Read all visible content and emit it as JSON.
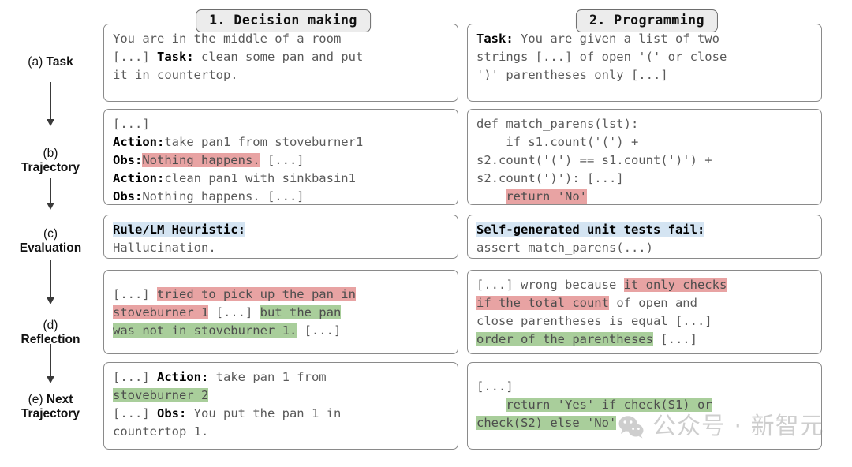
{
  "stages": [
    {
      "index": "(a)",
      "name": "Task",
      "inline": true
    },
    {
      "index": "(b)",
      "name": "Trajectory",
      "inline": false
    },
    {
      "index": "(c)",
      "name": "Evaluation",
      "inline": false
    },
    {
      "index": "(d)",
      "name": "Reflection",
      "inline": false
    },
    {
      "index": "(e)",
      "name": "Next",
      "name2": "Trajectory",
      "inline": true
    }
  ],
  "columns": [
    {
      "title": "1. Decision making",
      "task": {
        "lines": [
          {
            "segments": [
              {
                "t": "You are in the middle of a room",
                "style": "plain"
              }
            ]
          },
          {
            "segments": [
              {
                "t": "[...] ",
                "style": "plain"
              },
              {
                "t": "Task:",
                "style": "bold"
              },
              {
                "t": " clean some pan and put",
                "style": "plain"
              }
            ]
          },
          {
            "segments": [
              {
                "t": "it in countertop.",
                "style": "plain"
              }
            ]
          }
        ]
      },
      "trajectory": {
        "lines": [
          {
            "segments": [
              {
                "t": "[...]",
                "style": "plain"
              }
            ]
          },
          {
            "segments": [
              {
                "t": "Action:",
                "style": "bold"
              },
              {
                "t": "take pan1 from stoveburner1",
                "style": "plain"
              }
            ]
          },
          {
            "segments": [
              {
                "t": "Obs:",
                "style": "bold"
              },
              {
                "t": "Nothing happens.",
                "style": "red"
              },
              {
                "t": " [...]",
                "style": "plain"
              }
            ]
          },
          {
            "segments": [
              {
                "t": "Action:",
                "style": "bold"
              },
              {
                "t": "clean pan1 with sinkbasin1",
                "style": "plain"
              }
            ]
          },
          {
            "segments": [
              {
                "t": "Obs:",
                "style": "bold"
              },
              {
                "t": "Nothing happens. [...]",
                "style": "plain"
              }
            ]
          }
        ]
      },
      "evaluation": {
        "lines": [
          {
            "segments": [
              {
                "t": "Rule/LM Heuristic:",
                "style": "blue-bold"
              }
            ]
          },
          {
            "segments": [
              {
                "t": "Hallucination.",
                "style": "plain"
              }
            ]
          }
        ]
      },
      "reflection": {
        "lines": [
          {
            "segments": [
              {
                "t": "[...] ",
                "style": "plain"
              },
              {
                "t": "tried to pick up the pan in",
                "style": "red"
              }
            ]
          },
          {
            "segments": [
              {
                "t": "stoveburner 1",
                "style": "red"
              },
              {
                "t": " [...] ",
                "style": "plain"
              },
              {
                "t": "but the pan",
                "style": "green"
              }
            ]
          },
          {
            "segments": [
              {
                "t": "was not in stoveburner 1.",
                "style": "green"
              },
              {
                "t": " [...]",
                "style": "plain"
              }
            ]
          }
        ]
      },
      "next": {
        "lines": [
          {
            "segments": [
              {
                "t": "[...] ",
                "style": "plain"
              },
              {
                "t": "Action:",
                "style": "bold"
              },
              {
                "t": " take pan 1 from",
                "style": "plain"
              }
            ]
          },
          {
            "segments": [
              {
                "t": "stoveburner 2",
                "style": "green"
              }
            ]
          },
          {
            "segments": [
              {
                "t": "[...] ",
                "style": "plain"
              },
              {
                "t": "Obs:",
                "style": "bold"
              },
              {
                "t": " You put the pan 1 in",
                "style": "plain"
              }
            ]
          },
          {
            "segments": [
              {
                "t": "countertop 1.",
                "style": "plain"
              }
            ]
          }
        ]
      }
    },
    {
      "title": "2. Programming",
      "task": {
        "lines": [
          {
            "segments": [
              {
                "t": "Task:",
                "style": "bold"
              },
              {
                "t": " You are given a list of two",
                "style": "plain"
              }
            ]
          },
          {
            "segments": [
              {
                "t": "strings [...] of open '(' or close",
                "style": "plain"
              }
            ]
          },
          {
            "segments": [
              {
                "t": "')' parentheses only [...]",
                "style": "plain"
              }
            ]
          }
        ]
      },
      "trajectory": {
        "lines": [
          {
            "segments": [
              {
                "t": "def match_parens(lst):",
                "style": "plain"
              }
            ]
          },
          {
            "segments": [
              {
                "t": "    if s1.count('(') +",
                "style": "plain"
              }
            ]
          },
          {
            "segments": [
              {
                "t": "s2.count('(') == s1.count(')') +",
                "style": "plain"
              }
            ]
          },
          {
            "segments": [
              {
                "t": "s2.count(')'): [...]",
                "style": "plain"
              }
            ]
          },
          {
            "segments": [
              {
                "t": "    ",
                "style": "plain"
              },
              {
                "t": "return 'No'",
                "style": "red"
              }
            ]
          }
        ]
      },
      "evaluation": {
        "lines": [
          {
            "segments": [
              {
                "t": "Self-generated unit tests fail:",
                "style": "blue-bold"
              }
            ]
          },
          {
            "segments": [
              {
                "t": "assert match_parens(...)",
                "style": "plain"
              }
            ]
          }
        ]
      },
      "reflection": {
        "lines": [
          {
            "segments": [
              {
                "t": "[...] wrong because ",
                "style": "plain"
              },
              {
                "t": "it only checks",
                "style": "red"
              }
            ]
          },
          {
            "segments": [
              {
                "t": "if the total count",
                "style": "red"
              },
              {
                "t": " of open and",
                "style": "plain"
              }
            ]
          },
          {
            "segments": [
              {
                "t": "close parentheses is equal [...]",
                "style": "plain"
              }
            ]
          },
          {
            "segments": [
              {
                "t": "order of the parentheses",
                "style": "green"
              },
              {
                "t": " [...]",
                "style": "plain"
              }
            ]
          }
        ]
      },
      "next": {
        "lines": [
          {
            "segments": [
              {
                "t": "[...]",
                "style": "plain"
              }
            ]
          },
          {
            "segments": [
              {
                "t": "    ",
                "style": "plain"
              },
              {
                "t": "return 'Yes' if check(S1) or",
                "style": "green"
              }
            ]
          },
          {
            "segments": [
              {
                "t": "check(S2) else 'No'",
                "style": "green"
              }
            ]
          }
        ]
      }
    }
  ],
  "watermark": {
    "icon": "wechat-icon",
    "text": "公众号 · 新智元"
  },
  "colors": {
    "highlight_red": "#e8a3a3",
    "highlight_green": "#a9ce9b",
    "highlight_blue": "#d4e4f2",
    "box_border": "#8a8a8a",
    "title_fill": "#ececec",
    "body_text": "#5a5a5a"
  }
}
